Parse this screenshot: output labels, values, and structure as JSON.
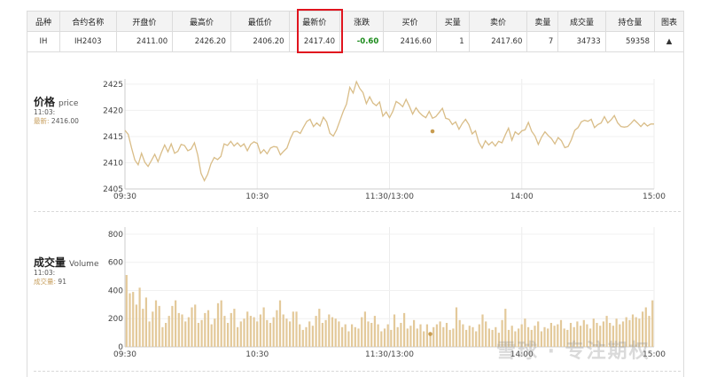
{
  "table": {
    "headers": [
      "品种",
      "合约名称",
      "开盘价",
      "最高价",
      "最低价",
      "最新价",
      "涨跌",
      "买价",
      "买量",
      "卖价",
      "卖量",
      "成交量",
      "持仓量",
      "图表"
    ],
    "row": {
      "variety": "IH",
      "contract": "IH2403",
      "open": "2411.00",
      "high": "2426.20",
      "low": "2406.20",
      "last": "2417.40",
      "change": "-0.60",
      "bid": "2416.60",
      "bid_vol": "1",
      "ask": "2417.60",
      "ask_vol": "7",
      "volume": "34733",
      "open_interest": "59358",
      "chart_toggle": "▲"
    },
    "colors": {
      "negative": "#1a8a1a",
      "highlight": "#e0141e"
    }
  },
  "price_panel": {
    "title": "价格",
    "title_en": "price",
    "time": "11:03:",
    "label": "最新:",
    "value": "2416.00"
  },
  "volume_panel": {
    "title": "成交量",
    "title_en": "Volume",
    "time": "11:03:",
    "label": "成交量:",
    "value": "91"
  },
  "watermark": "雪球 · 专注期权",
  "chart_data": [
    {
      "type": "line",
      "color": "#d9bd88",
      "ylim": [
        2405,
        2426
      ],
      "y_ticks": [
        "2405",
        "2410",
        "2415",
        "2420",
        "2425"
      ],
      "x_ticks": [
        "09:30",
        "10:30",
        "11:30/13:00",
        "14:00",
        "15:00"
      ],
      "grid": true,
      "legend": "none",
      "cursor_point": {
        "x_index": 93,
        "y": 2416
      },
      "values": [
        2416.2,
        2415.4,
        2412.8,
        2410.5,
        2409.6,
        2411.8,
        2410.1,
        2409.3,
        2410.4,
        2411.6,
        2410.2,
        2411.9,
        2413.4,
        2412.1,
        2413.6,
        2411.8,
        2412.2,
        2413.5,
        2413.3,
        2412.3,
        2412.6,
        2413.8,
        2411.5,
        2408.0,
        2406.6,
        2407.8,
        2409.8,
        2411.0,
        2410.6,
        2411.2,
        2413.6,
        2413.3,
        2414.1,
        2413.2,
        2413.8,
        2413.1,
        2413.6,
        2412.3,
        2413.5,
        2414.0,
        2413.7,
        2411.8,
        2412.5,
        2411.7,
        2412.8,
        2413.1,
        2413.0,
        2411.5,
        2412.2,
        2412.8,
        2414.6,
        2415.9,
        2416.0,
        2415.6,
        2416.8,
        2417.9,
        2418.3,
        2416.9,
        2417.6,
        2417.0,
        2418.7,
        2417.8,
        2415.6,
        2415.1,
        2416.3,
        2418.0,
        2419.8,
        2421.2,
        2424.4,
        2423.3,
        2425.5,
        2424.2,
        2423.4,
        2421.3,
        2422.6,
        2421.4,
        2420.9,
        2421.6,
        2418.9,
        2419.7,
        2418.6,
        2419.8,
        2421.7,
        2421.3,
        2420.7,
        2422.1,
        2420.8,
        2419.3,
        2420.5,
        2419.6,
        2419.0,
        2418.6,
        2419.8,
        2418.5,
        2418.8,
        2419.6,
        2420.4,
        2418.5,
        2418.3,
        2417.3,
        2417.8,
        2416.4,
        2417.5,
        2418.3,
        2417.3,
        2415.5,
        2416.1,
        2413.9,
        2412.8,
        2414.2,
        2413.4,
        2414.0,
        2413.2,
        2414.1,
        2413.8,
        2415.3,
        2416.6,
        2414.3,
        2415.9,
        2415.4,
        2416.1,
        2416.3,
        2417.7,
        2416.0,
        2415.1,
        2413.5,
        2414.9,
        2415.9,
        2415.2,
        2414.6,
        2413.6,
        2414.8,
        2414.2,
        2412.9,
        2413.1,
        2414.4,
        2416.2,
        2416.7,
        2417.8,
        2418.1,
        2417.9,
        2418.3,
        2416.7,
        2417.3,
        2417.6,
        2418.8,
        2417.6,
        2418.2,
        2419.0,
        2417.6,
        2416.9,
        2416.8,
        2416.9,
        2417.5,
        2418.2,
        2417.6,
        2416.9,
        2417.6,
        2417.0,
        2417.4,
        2417.4
      ]
    },
    {
      "type": "bar",
      "color": "#e3c99a",
      "ylim": [
        0,
        850
      ],
      "y_ticks": [
        "0",
        "200",
        "400",
        "600",
        "800"
      ],
      "x_ticks": [
        "09:30",
        "10:30",
        "11:30/13:00",
        "14:00",
        "15:00"
      ],
      "grid": true,
      "legend": "none",
      "cursor_point": {
        "x_index": 93,
        "y": 91
      },
      "values": [
        510,
        380,
        390,
        300,
        420,
        270,
        350,
        180,
        250,
        330,
        290,
        140,
        170,
        220,
        290,
        330,
        240,
        230,
        180,
        210,
        280,
        300,
        170,
        190,
        240,
        260,
        160,
        200,
        310,
        330,
        220,
        170,
        240,
        270,
        140,
        180,
        200,
        250,
        220,
        210,
        180,
        230,
        280,
        190,
        170,
        210,
        260,
        330,
        230,
        200,
        180,
        250,
        250,
        160,
        120,
        140,
        180,
        150,
        220,
        270,
        170,
        190,
        230,
        210,
        200,
        180,
        140,
        160,
        110,
        160,
        140,
        130,
        210,
        250,
        180,
        170,
        220,
        160,
        110,
        130,
        160,
        120,
        230,
        140,
        170,
        240,
        130,
        150,
        190,
        130,
        160,
        110,
        160,
        91,
        140,
        160,
        180,
        140,
        170,
        120,
        130,
        280,
        190,
        160,
        120,
        150,
        140,
        110,
        160,
        230,
        180,
        130,
        120,
        140,
        100,
        190,
        270,
        120,
        150,
        110,
        130,
        160,
        200,
        140,
        120,
        150,
        180,
        110,
        140,
        130,
        170,
        150,
        160,
        190,
        130,
        120,
        170,
        140,
        180,
        150,
        190,
        160,
        130,
        200,
        170,
        150,
        180,
        220,
        170,
        150,
        200,
        160,
        180,
        210,
        190,
        230,
        210,
        200,
        250,
        280,
        220,
        330
      ]
    }
  ]
}
